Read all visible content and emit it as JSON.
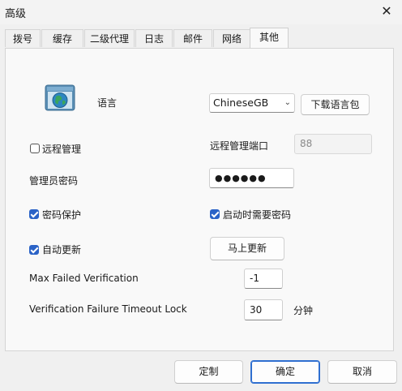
{
  "window": {
    "title": "高级",
    "close": "✕"
  },
  "tabs": [
    {
      "label": "拨号"
    },
    {
      "label": "缓存"
    },
    {
      "label": "二级代理"
    },
    {
      "label": "日志"
    },
    {
      "label": "邮件"
    },
    {
      "label": "网络"
    },
    {
      "label": "其他"
    }
  ],
  "active_tab": "其他",
  "language": {
    "label": "语言",
    "value": "ChineseGB",
    "download_button": "下载语言包"
  },
  "remote": {
    "label": "远程管理",
    "checked": false,
    "port_label": "远程管理端口",
    "port_value": "88"
  },
  "admin_password": {
    "label": "管理员密码",
    "value": "●●●●●●"
  },
  "password_protect": {
    "label": "密码保护",
    "checked": true
  },
  "startup_password": {
    "label": "启动时需要密码",
    "checked": true
  },
  "auto_update": {
    "label": "自动更新",
    "checked": true,
    "update_now_button": "马上更新"
  },
  "max_failed": {
    "label": "Max Failed Verification",
    "value": "-1"
  },
  "timeout_lock": {
    "label": "Verification Failure Timeout Lock",
    "value": "30",
    "unit": "分钟"
  },
  "footer": {
    "customize": "定制",
    "ok": "确定",
    "cancel": "取消"
  },
  "colors": {
    "accent": "#2b63c7",
    "background": "#f0f0f0",
    "panel": "#f9f9f9"
  },
  "icons": {
    "app_icon": "globe-window-icon",
    "dropdown": "chevron-down-icon"
  }
}
